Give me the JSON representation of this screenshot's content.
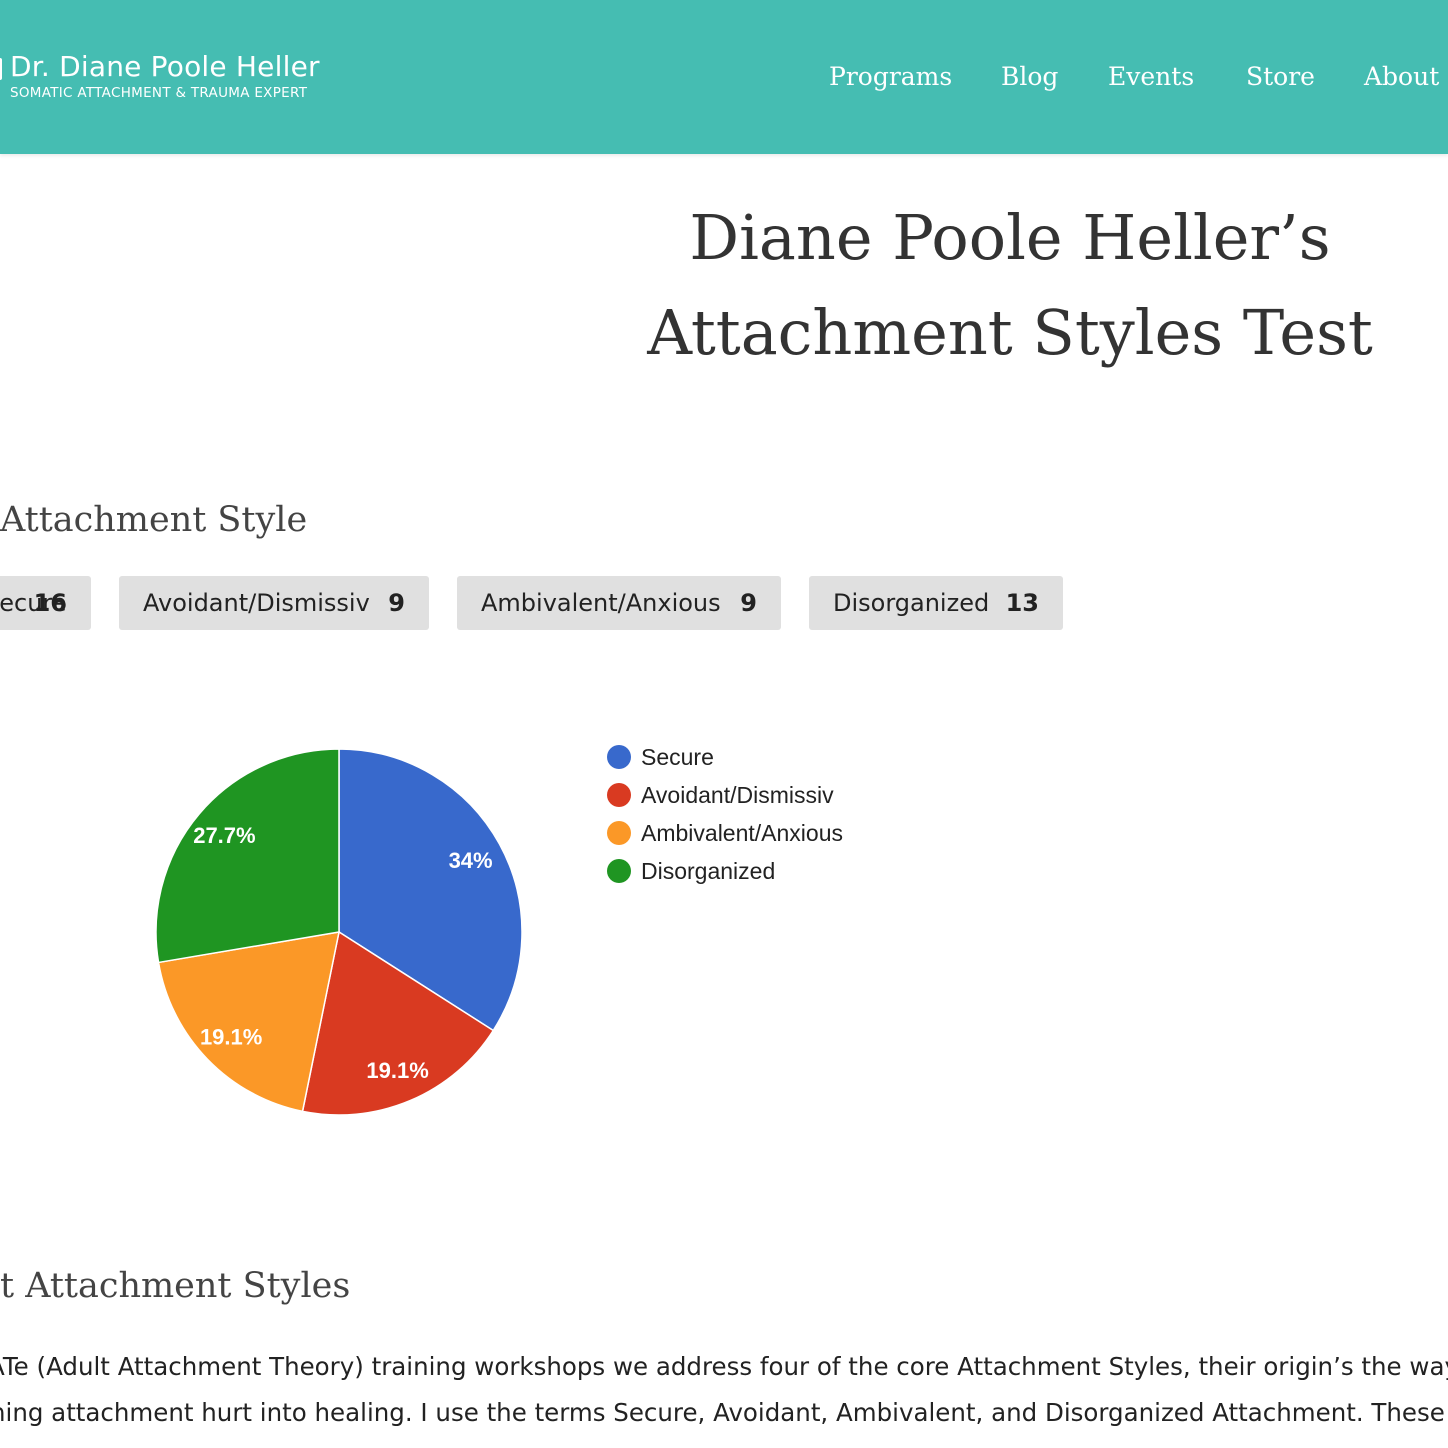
{
  "header": {
    "logo_title": "Dr. Diane Poole Heller",
    "logo_subtitle": "SOMATIC ATTACHMENT & TRAUMA EXPERT",
    "nav": [
      {
        "label": "Programs"
      },
      {
        "label": "Blog"
      },
      {
        "label": "Events"
      },
      {
        "label": "Store"
      },
      {
        "label": "About D"
      }
    ]
  },
  "page_title_line1": "Diane Poole Heller’s",
  "page_title_line2": "Attachment Styles Test",
  "results_heading": "Attachment Style",
  "scores": [
    {
      "label": "Secure",
      "count": "16"
    },
    {
      "label": "Avoidant/Dismissiv",
      "count": "9"
    },
    {
      "label": "Ambivalent/Anxious",
      "count": "9"
    },
    {
      "label": "Disorganized",
      "count": "13"
    }
  ],
  "chart_data": {
    "type": "pie",
    "categories": [
      "Secure",
      "Avoidant/Dismissiv",
      "Ambivalent/Anxious",
      "Disorganized"
    ],
    "values": [
      16,
      9,
      9,
      13
    ],
    "slice_labels": [
      "34%",
      "19.1%",
      "19.1%",
      "27.7%"
    ],
    "colors": [
      "#3869cc",
      "#d93a21",
      "#fb9827",
      "#1f9522"
    ],
    "legend_position": "right"
  },
  "about_heading": "t Attachment Styles",
  "body_lines": [
    "SATe (Adult Attachment Theory) training workshops we address four of the core Attachment Styles, their origin’s the way th",
    "rming attachment hurt into healing. I use the terms Secure, Avoidant, Ambivalent, and Disorganized Attachment. These ar"
  ]
}
